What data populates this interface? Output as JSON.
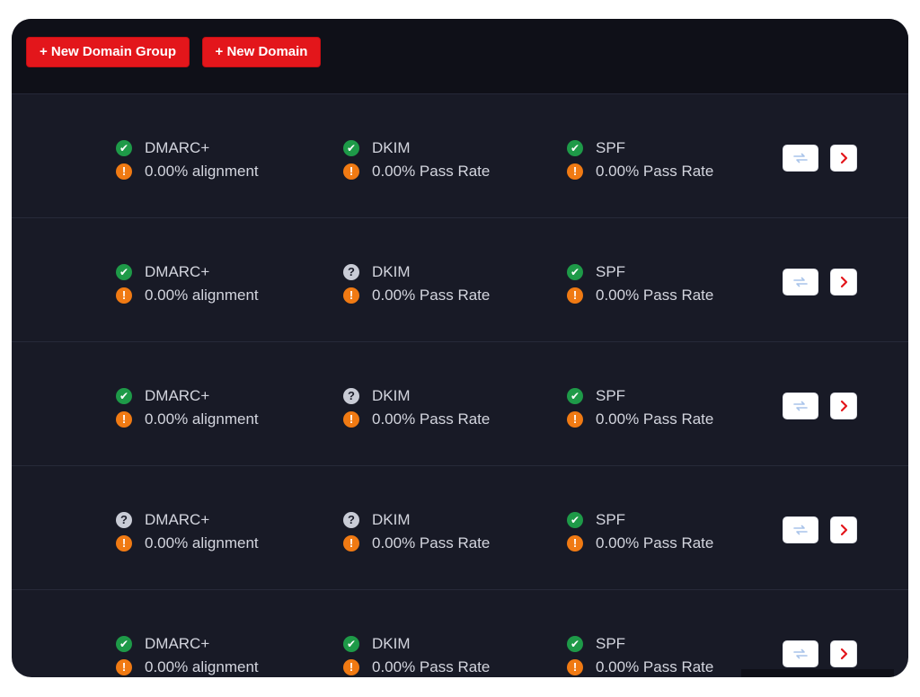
{
  "toolbar": {
    "new_domain_group_label": "+ New Domain Group",
    "new_domain_label": "+ New Domain"
  },
  "colors": {
    "accent_red": "#e3161b",
    "status_ok": "#1e9a48",
    "status_unknown": "#c9ccd6",
    "status_warning": "#f07a13",
    "panel_bg": "#181a26"
  },
  "rows": [
    {
      "dmarc": {
        "name": "DMARC+",
        "status": "ok",
        "detail": "0.00% alignment",
        "detail_status": "warning"
      },
      "dkim": {
        "name": "DKIM",
        "status": "ok",
        "detail": "0.00% Pass Rate",
        "detail_status": "warning"
      },
      "spf": {
        "name": "SPF",
        "status": "ok",
        "detail": "0.00% Pass Rate",
        "detail_status": "warning"
      }
    },
    {
      "dmarc": {
        "name": "DMARC+",
        "status": "ok",
        "detail": "0.00% alignment",
        "detail_status": "warning"
      },
      "dkim": {
        "name": "DKIM",
        "status": "unknown",
        "detail": "0.00% Pass Rate",
        "detail_status": "warning"
      },
      "spf": {
        "name": "SPF",
        "status": "ok",
        "detail": "0.00% Pass Rate",
        "detail_status": "warning"
      }
    },
    {
      "dmarc": {
        "name": "DMARC+",
        "status": "ok",
        "detail": "0.00% alignment",
        "detail_status": "warning"
      },
      "dkim": {
        "name": "DKIM",
        "status": "unknown",
        "detail": "0.00% Pass Rate",
        "detail_status": "warning"
      },
      "spf": {
        "name": "SPF",
        "status": "ok",
        "detail": "0.00% Pass Rate",
        "detail_status": "warning"
      }
    },
    {
      "dmarc": {
        "name": "DMARC+",
        "status": "unknown",
        "detail": "0.00% alignment",
        "detail_status": "warning"
      },
      "dkim": {
        "name": "DKIM",
        "status": "unknown",
        "detail": "0.00% Pass Rate",
        "detail_status": "warning"
      },
      "spf": {
        "name": "SPF",
        "status": "ok",
        "detail": "0.00% Pass Rate",
        "detail_status": "warning"
      }
    },
    {
      "dmarc": {
        "name": "DMARC+",
        "status": "ok",
        "detail": "0.00% alignment",
        "detail_status": "warning"
      },
      "dkim": {
        "name": "DKIM",
        "status": "ok",
        "detail": "0.00% Pass Rate",
        "detail_status": "warning"
      },
      "spf": {
        "name": "SPF",
        "status": "ok",
        "detail": "0.00% Pass Rate",
        "detail_status": "warning"
      }
    }
  ],
  "icons": {
    "ok": "check-circle-icon",
    "unknown": "question-circle-icon",
    "warning": "exclamation-circle-icon",
    "sync": "sync-icon",
    "open": "chevron-right-icon"
  }
}
